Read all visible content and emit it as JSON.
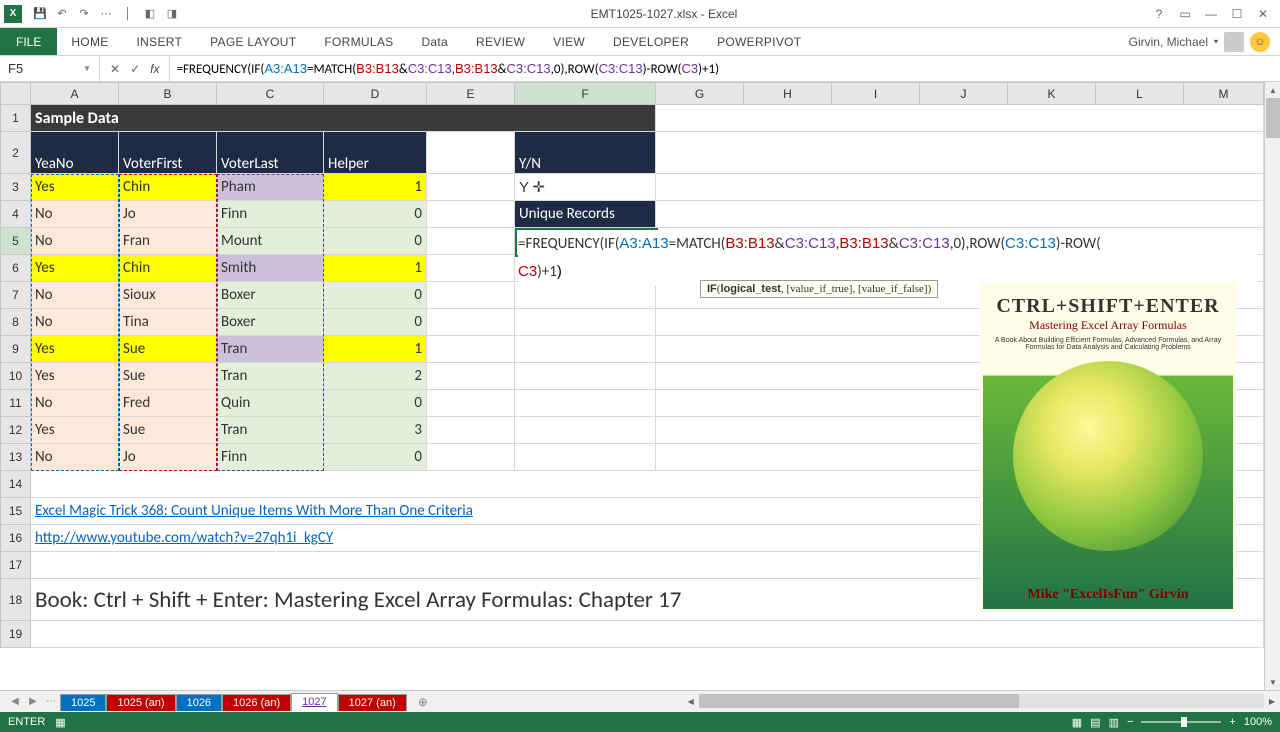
{
  "app": {
    "title": "EMT1025-1027.xlsx - Excel"
  },
  "qat": {
    "save": "💾",
    "undo": "↶",
    "redo": "↷"
  },
  "ribbon": {
    "file": "FILE",
    "tabs": [
      "HOME",
      "INSERT",
      "PAGE LAYOUT",
      "FORMULAS",
      "Data",
      "REVIEW",
      "VIEW",
      "DEVELOPER",
      "POWERPIVOT"
    ],
    "user": "Girvin, Michael"
  },
  "formulabar": {
    "name": "F5",
    "cancel": "✕",
    "enter": "✓",
    "fx": "fx",
    "formula_plain": "=FREQUENCY(IF(A3:A13=MATCH(B3:B13&C3:C13,B3:B13&C3:C13,0),ROW(C3:C13)-ROW(C3)+1)"
  },
  "columns": [
    "A",
    "B",
    "C",
    "D",
    "E",
    "F",
    "G",
    "H",
    "I",
    "J",
    "K",
    "L",
    "M"
  ],
  "rows": {
    "count": 19
  },
  "sheet": {
    "title": "Sample Data",
    "headers": {
      "A": "YeaNo",
      "B": "VoterFirst",
      "C": "VoterLast",
      "D": "Helper",
      "F": "Y/N"
    },
    "data": [
      {
        "A": "Yes",
        "B": "Chin",
        "C": "Pham",
        "D": "1"
      },
      {
        "A": "No",
        "B": "Jo",
        "C": "Finn",
        "D": "0"
      },
      {
        "A": "No",
        "B": "Fran",
        "C": "Mount",
        "D": "0"
      },
      {
        "A": "Yes",
        "B": "Chin",
        "C": "Smith",
        "D": "1"
      },
      {
        "A": "No",
        "B": "Sioux",
        "C": "Boxer",
        "D": "0"
      },
      {
        "A": "No",
        "B": "Tina",
        "C": "Boxer",
        "D": "0"
      },
      {
        "A": "Yes",
        "B": "Sue",
        "C": "Tran",
        "D": "1"
      },
      {
        "A": "Yes",
        "B": "Sue",
        "C": "Tran",
        "D": "2"
      },
      {
        "A": "No",
        "B": "Fred",
        "C": "Quin",
        "D": "0"
      },
      {
        "A": "Yes",
        "B": "Sue",
        "C": "Tran",
        "D": "3"
      },
      {
        "A": "No",
        "B": "Jo",
        "C": "Finn",
        "D": "0"
      }
    ],
    "f3": "Y",
    "f4": "Unique Records",
    "linktext": "Excel Magic Trick 368: Count Unique Items With More Than One Criteria ",
    "linkurl": "http://www.youtube.com/watch?v=27qh1i_kgCY",
    "booktext": "Book: Ctrl + Shift + Enter: Mastering Excel Array Formulas: Chapter 17"
  },
  "overlayformula": {
    "pre": "=FREQUENCY(IF(",
    "r1": "A3:A13",
    "eq": "=MATCH(",
    "r2a": "B3:B13",
    "amp": "&",
    "r3a": "C3:C13",
    "comma": ",",
    "r2b": "B3:B13",
    "r3b": "C3:C13",
    "mid": ",0),ROW(",
    "r4": "C3:C13",
    "mid2": ")-ROW(",
    "r5": "C3",
    "tail": ")+1)"
  },
  "tooltip": "IF(logical_test, [value_if_true], [value_if_false])",
  "book": {
    "title1": "CTRL+SHIFT+ENTER",
    "title2": "Mastering Excel Array Formulas",
    "sub": "A Book About Building Efficient Formulas, Advanced Formulas, and Array Formulas for Data Analysis and Calculating Problems",
    "author": "Mike \"ExcelIsFun\" Girvin"
  },
  "sheets": [
    "1025",
    "1025 (an)",
    "1026",
    "1026 (an)",
    "1027",
    "1027 (an)"
  ],
  "status": {
    "mode": "ENTER",
    "zoom": "100%"
  }
}
